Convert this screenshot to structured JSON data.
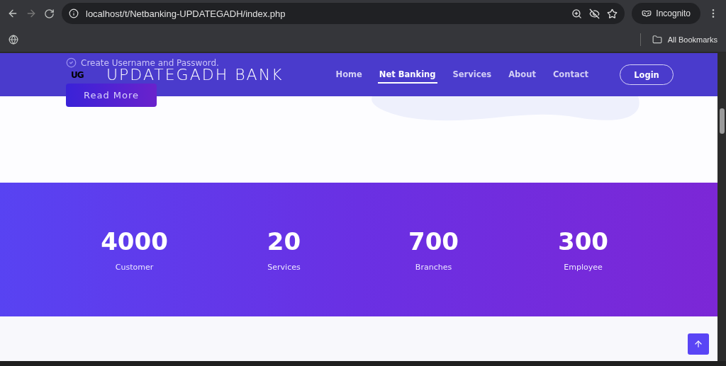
{
  "browser": {
    "url": "localhost/t/Netbanking-UPDATEGADH/index.php",
    "profile": "Incognito",
    "bookmarks_label": "All Bookmarks"
  },
  "hero": {
    "check_item": "Create Username and Password.",
    "read_more": "Read More"
  },
  "header": {
    "logo": "UG",
    "brand": "UPDATEGADH BANK",
    "login": "Login",
    "nav": [
      {
        "label": "Home",
        "selected": false
      },
      {
        "label": "Net Banking",
        "selected": true
      },
      {
        "label": "Services",
        "selected": false
      },
      {
        "label": "About",
        "selected": false
      },
      {
        "label": "Contact",
        "selected": false
      }
    ]
  },
  "stats": [
    {
      "value": "4000",
      "label": "Customer"
    },
    {
      "value": "20",
      "label": "Services"
    },
    {
      "value": "700",
      "label": "Branches"
    },
    {
      "value": "300",
      "label": "Employee"
    }
  ]
}
